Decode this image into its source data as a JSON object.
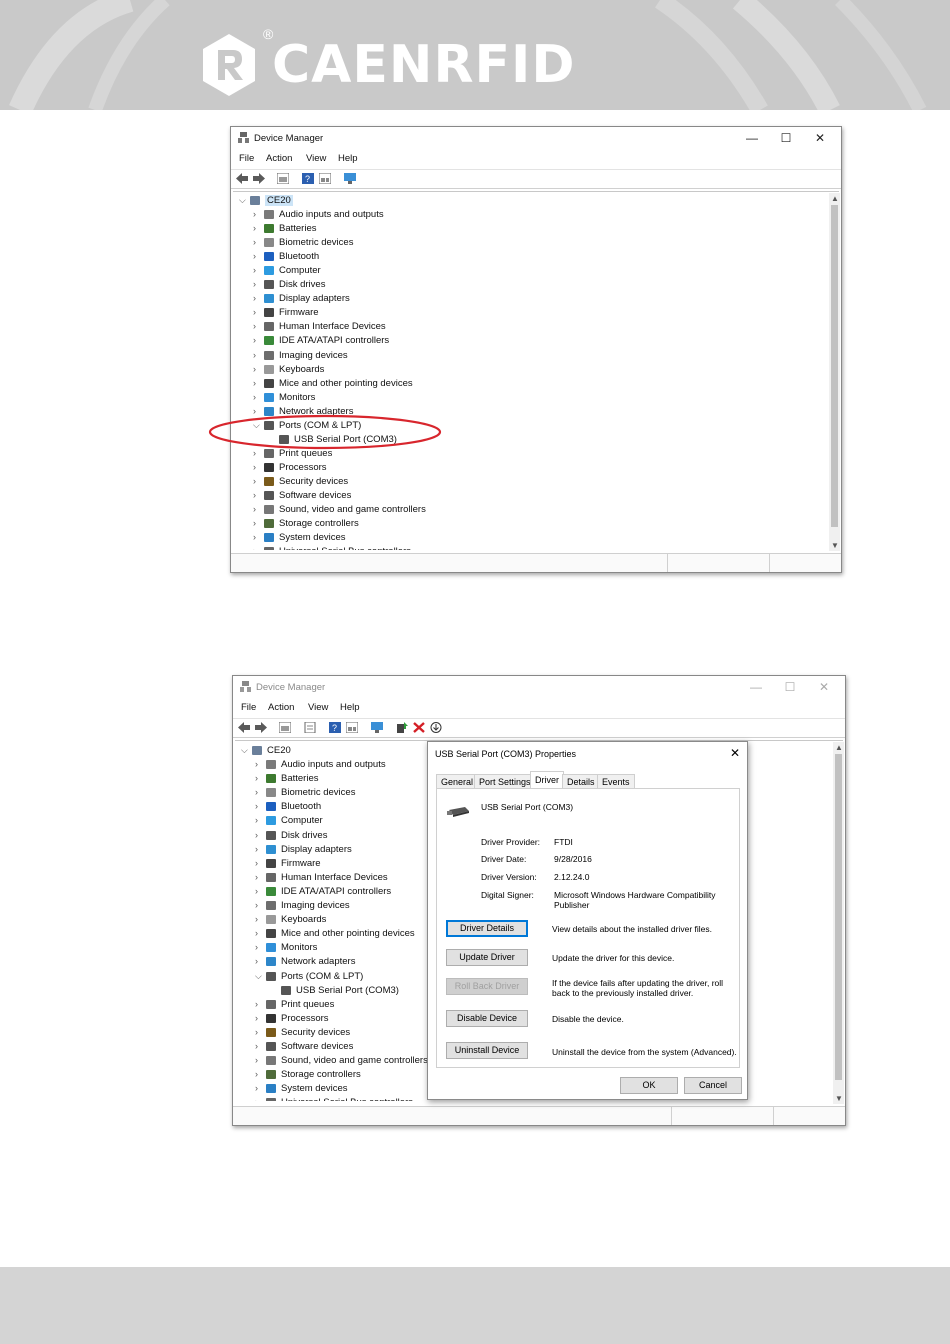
{
  "brand": {
    "name": "CAENRFID",
    "registered": "®"
  },
  "window1": {
    "title": "Device Manager",
    "controls": {
      "min": "—",
      "max": "☐",
      "close": "✕"
    },
    "menu": [
      "File",
      "Action",
      "View",
      "Help"
    ],
    "root": "CE20",
    "items": [
      "Audio inputs and outputs",
      "Batteries",
      "Biometric devices",
      "Bluetooth",
      "Computer",
      "Disk drives",
      "Display adapters",
      "Firmware",
      "Human Interface Devices",
      "IDE ATA/ATAPI controllers",
      "Imaging devices",
      "Keyboards",
      "Mice and other pointing devices",
      "Monitors",
      "Network adapters",
      "Ports (COM & LPT)",
      "USB Serial Port (COM3)",
      "Print queues",
      "Processors",
      "Security devices",
      "Software devices",
      "Sound, video and game controllers",
      "Storage controllers",
      "System devices",
      "Universal Serial Bus controllers"
    ]
  },
  "window2": {
    "title": "Device Manager",
    "controls": {
      "min": "—",
      "max": "☐",
      "close": "✕"
    },
    "menu": [
      "File",
      "Action",
      "View",
      "Help"
    ],
    "root": "CE20",
    "items": [
      "Audio inputs and outputs",
      "Batteries",
      "Biometric devices",
      "Bluetooth",
      "Computer",
      "Disk drives",
      "Display adapters",
      "Firmware",
      "Human Interface Devices",
      "IDE ATA/ATAPI controllers",
      "Imaging devices",
      "Keyboards",
      "Mice and other pointing devices",
      "Monitors",
      "Network adapters",
      "Ports (COM & LPT)",
      "USB Serial Port (COM3)",
      "Print queues",
      "Processors",
      "Security devices",
      "Software devices",
      "Sound, video and game controllers",
      "Storage controllers",
      "System devices",
      "Universal Serial Bus controllers"
    ]
  },
  "dialog": {
    "title": "USB Serial Port (COM3) Properties",
    "close": "✕",
    "tabs": [
      "General",
      "Port Settings",
      "Driver",
      "Details",
      "Events"
    ],
    "device_name": "USB Serial Port (COM3)",
    "fields": [
      {
        "label": "Driver Provider:",
        "value": "FTDI"
      },
      {
        "label": "Driver Date:",
        "value": "9/28/2016"
      },
      {
        "label": "Driver Version:",
        "value": "2.12.24.0"
      },
      {
        "label": "Digital Signer:",
        "value": "Microsoft Windows Hardware Compatibility Publisher"
      }
    ],
    "actions": [
      {
        "label": "Driver Details",
        "desc": "View details about the installed driver files."
      },
      {
        "label": "Update Driver",
        "desc": "Update the driver for this device."
      },
      {
        "label": "Roll Back Driver",
        "desc": "If the device fails after updating the driver, roll back to the previously installed driver."
      },
      {
        "label": "Disable Device",
        "desc": "Disable the device."
      },
      {
        "label": "Uninstall Device",
        "desc": "Uninstall the device from the system (Advanced)."
      }
    ],
    "ok": "OK",
    "cancel": "Cancel"
  },
  "icon_colors": [
    "#7a7a7a",
    "#3d7a2f",
    "#888888",
    "#1c5fbf",
    "#2d9be0",
    "#555555",
    "#2e8fd1",
    "#444444",
    "#666666",
    "#3a8a3a",
    "#6d6d6d",
    "#999999",
    "#444444",
    "#2f8fd8",
    "#2d86c9",
    "#555555",
    "#555555",
    "#666666",
    "#333333",
    "#7a5a1a",
    "#555555",
    "#777777",
    "#4f6b3a",
    "#2a7fc4",
    "#666666"
  ]
}
